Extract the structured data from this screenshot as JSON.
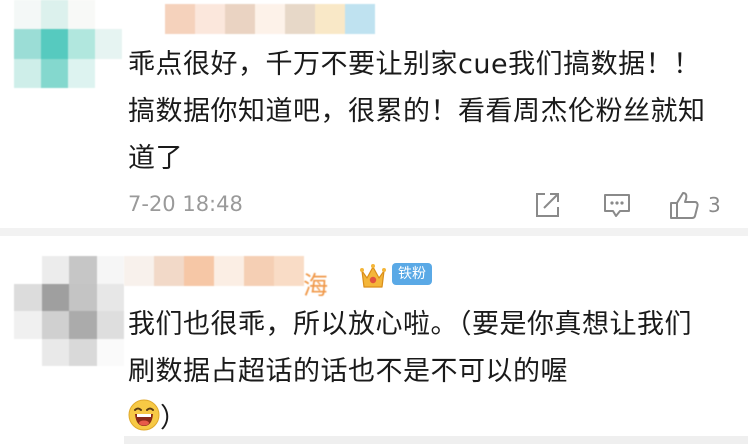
{
  "comment_1": {
    "text": "乖点很好，千万不要让别家cue我们搞数据！！搞数据你知道吧，很累的！看看周杰伦粉丝就知道了",
    "timestamp": "7-20 18:48",
    "like_count": "3",
    "icons": [
      "share-icon",
      "reply-icon",
      "like-icon"
    ]
  },
  "comment_2": {
    "name_visible": "海",
    "badge": "铁粉",
    "text": "我们也很乖，所以放心啦。（要是你真想让我们刷数据占超话的话也不是不可以的喔",
    "text_end": "）",
    "icons": [
      "crown-icon",
      "laugh-emoji-icon"
    ]
  },
  "colors": {
    "badge_bg": "#5aa9e6",
    "meta_gray": "#9a9a9a",
    "separator": "#f2f2f2"
  }
}
